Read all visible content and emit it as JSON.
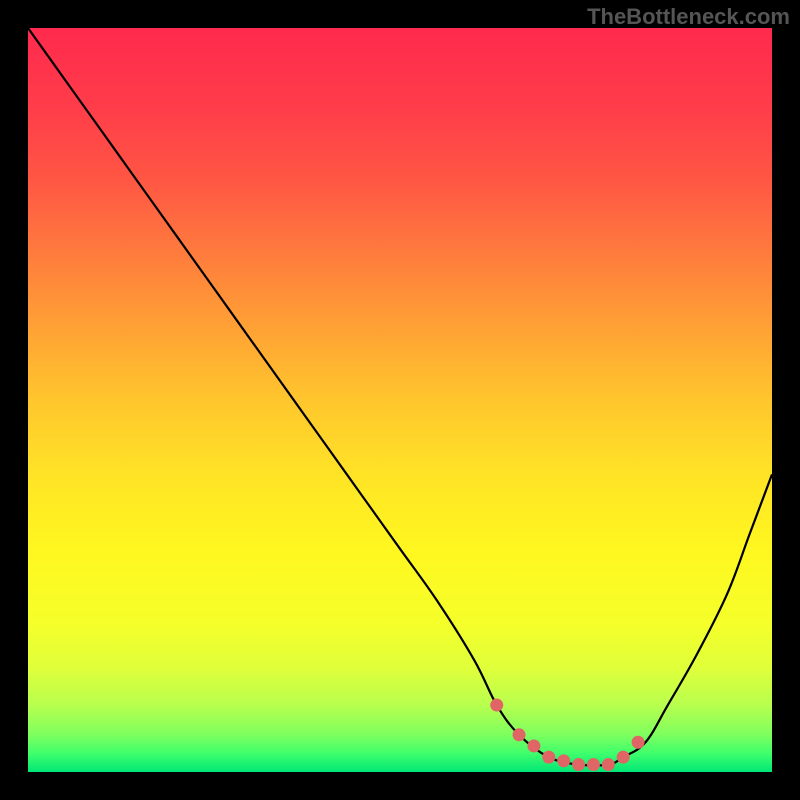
{
  "watermark": "TheBottleneck.com",
  "chart_data": {
    "type": "line",
    "title": "",
    "xlabel": "",
    "ylabel": "",
    "xlim": [
      0,
      100
    ],
    "ylim": [
      0,
      100
    ],
    "grid": false,
    "legend": false,
    "series": [
      {
        "name": "bottleneck-curve",
        "x": [
          0,
          5,
          10,
          15,
          20,
          25,
          30,
          35,
          40,
          45,
          50,
          55,
          60,
          63,
          66,
          70,
          74,
          78,
          80,
          83,
          86,
          90,
          94,
          97,
          100
        ],
        "values": [
          100,
          93,
          86,
          79,
          72,
          65,
          58,
          51,
          44,
          37,
          30,
          23,
          15,
          9,
          5,
          2,
          1,
          1,
          2,
          4,
          9,
          16,
          24,
          32,
          40
        ]
      }
    ],
    "markers": {
      "name": "bottleneck-markers",
      "color": "#e06666",
      "x": [
        63,
        66,
        68,
        70,
        72,
        74,
        76,
        78,
        80,
        82
      ],
      "values": [
        9,
        5,
        3.5,
        2,
        1.5,
        1,
        1,
        1,
        2,
        4
      ]
    },
    "gradient_stops": [
      {
        "offset": 0.0,
        "color": "#ff2a4d"
      },
      {
        "offset": 0.1,
        "color": "#ff3b4a"
      },
      {
        "offset": 0.2,
        "color": "#ff5544"
      },
      {
        "offset": 0.3,
        "color": "#ff7a3d"
      },
      {
        "offset": 0.4,
        "color": "#ffa035"
      },
      {
        "offset": 0.5,
        "color": "#ffc62d"
      },
      {
        "offset": 0.6,
        "color": "#ffe326"
      },
      {
        "offset": 0.7,
        "color": "#fff71f"
      },
      {
        "offset": 0.8,
        "color": "#f5ff2a"
      },
      {
        "offset": 0.86,
        "color": "#e0ff3a"
      },
      {
        "offset": 0.91,
        "color": "#b8ff4e"
      },
      {
        "offset": 0.95,
        "color": "#7dff5e"
      },
      {
        "offset": 0.975,
        "color": "#3fff6c"
      },
      {
        "offset": 1.0,
        "color": "#00e676"
      }
    ]
  }
}
